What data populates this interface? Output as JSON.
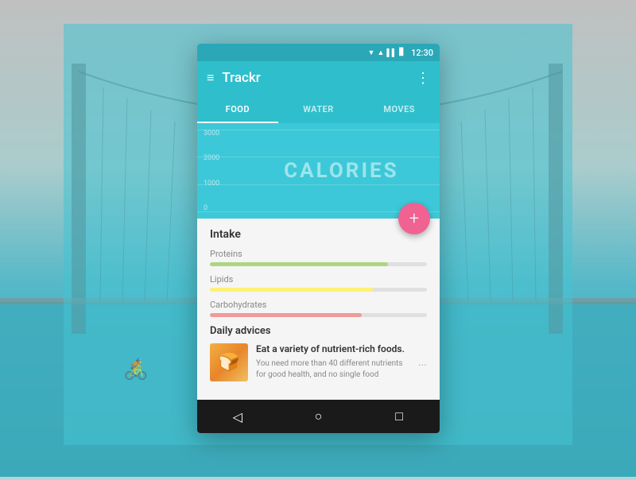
{
  "background": {
    "overlay_color": "rgba(70,195,210,0.55)"
  },
  "status_bar": {
    "time": "12:30",
    "icons": [
      "▼",
      "▲",
      "▌▌",
      "▊"
    ]
  },
  "app_bar": {
    "title": "Trackr",
    "menu_icon": "≡",
    "more_icon": "⋮"
  },
  "tabs": [
    {
      "label": "FOOD",
      "active": true
    },
    {
      "label": "WATER",
      "active": false
    },
    {
      "label": "MOVES",
      "active": false
    }
  ],
  "chart": {
    "calories_label": "CALORIES",
    "y_labels": [
      "3000",
      "2000",
      "1000",
      "0"
    ]
  },
  "fab": {
    "label": "+"
  },
  "intake": {
    "title": "Intake",
    "nutrients": [
      {
        "name": "Proteins",
        "bar_class": "bar-proteins",
        "width": "82%"
      },
      {
        "name": "Lipids",
        "bar_class": "bar-lipids",
        "width": "75%"
      },
      {
        "name": "Carbohydrates",
        "bar_class": "bar-carbs",
        "width": "70%"
      }
    ]
  },
  "daily_advices": {
    "title": "Daily advices",
    "items": [
      {
        "headline": "Eat a variety of nutrient-rich foods.",
        "body": "You need more than 40 different nutrients for good health, and no single food",
        "img_emoji": "🍞",
        "more": "..."
      }
    ]
  },
  "nav_bar": {
    "back_icon": "◁",
    "home_icon": "○",
    "square_icon": "□"
  }
}
